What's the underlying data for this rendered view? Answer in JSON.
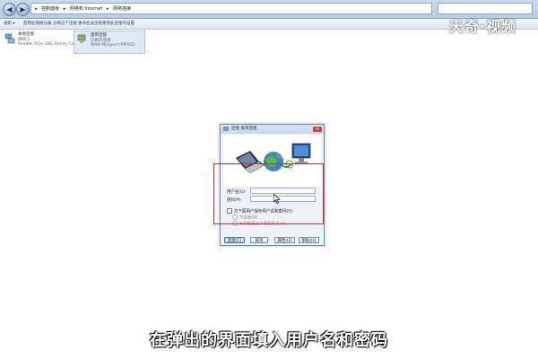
{
  "explorer": {
    "breadcrumb": [
      "控制面板",
      "网络和 Internet",
      "网络连接"
    ],
    "toolbar": [
      "组织 ▾",
      "禁用此网络设备",
      "诊断这个连接",
      "重命名此连接",
      "更改此连接的设置"
    ]
  },
  "connections": [
    {
      "name": "本地连接",
      "status": "网络 5",
      "device": "Realtek PCIe GBE Family Contr..."
    },
    {
      "name": "宽带连接",
      "status": "已断开连接",
      "device": "WAN Miniport (PPPOE)"
    }
  ],
  "watermark": "天奇·视频",
  "dialog": {
    "title": "连接 宽带连接",
    "close": "✕",
    "username_label": "用户名(U):",
    "username_value": "",
    "password_label": "密码(P):",
    "password_value": "",
    "save_label": "为下面用户保存用户名和密码(S):",
    "only_me": "只是我(N)",
    "anyone": "任何使用此计算机的人(A)",
    "buttons": {
      "connect": "连接(C)",
      "cancel": "取消",
      "properties": "属性(O)",
      "help": "帮助(H)"
    }
  },
  "subtitle": "在弹出的界面填入用户名和密码",
  "colors": {
    "highlight": "#d42a2a",
    "titlebar": "#c2d5ea",
    "selected": "#dfe9f5"
  }
}
